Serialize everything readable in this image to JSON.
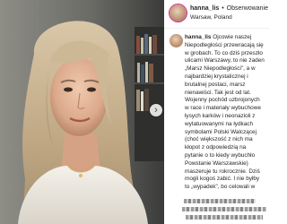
{
  "post": {
    "username": "hanna_lis",
    "separator": "•",
    "follow_label": "Obserwowanie",
    "location": "Warsaw, Poland",
    "caption_text": "Ojcowie naszej Niepodległości przewracają się w grobach. To co dziś przeszło ulicami Warszawy, to nie żaden „Marsz Niepodległości\", a w najbardziej krystalicznej i brutalnej postaci, marsz nienawiści. Tak jest od lat. Wojenny pochód uzbrojonych w race i materiały wybuchowe łysych karków i neonazioli z wytatuowanymi na łydkach symbolami Polski Walczącej (choć większość z nich ma kłopot z odpowiedzią na pytanie o to kiedy wybuchło Powstanie Warszawskie) maszeruje tu rokrocznie. Dziś mogli kogoś zabić. I nie byłby to „wypadek\", bo celowali w"
  },
  "media": {
    "next_arrow": "›"
  },
  "colors": {
    "text": "#262626",
    "story_ring": "#d6249f",
    "divider": "#efefef"
  }
}
